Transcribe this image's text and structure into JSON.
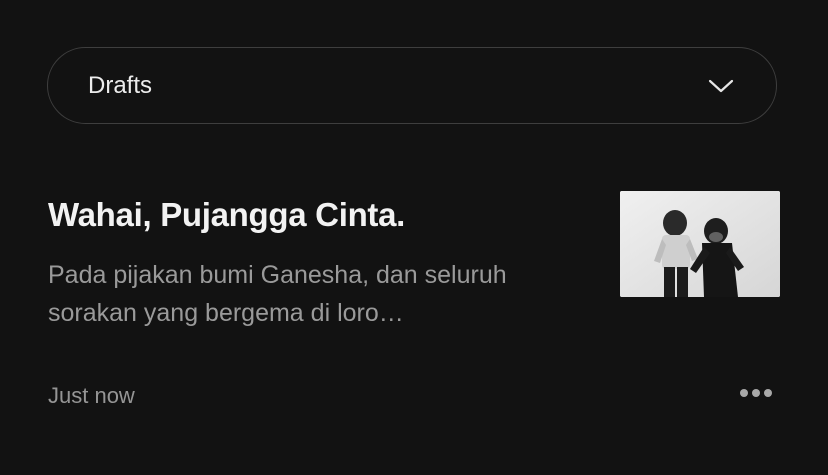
{
  "filter": {
    "selected": "Drafts",
    "icon": "chevron-down-icon"
  },
  "post": {
    "title": "Wahai, Pujangga Cinta.",
    "excerpt": "Pada pijakan bumi Ganesha, dan seluruh sorakan yang bergema di loro…",
    "timestamp": "Just now",
    "more_icon": "more-horizontal-icon"
  },
  "colors": {
    "background": "#121212",
    "border": "#3e3e3e",
    "title": "#f2f2f2",
    "muted": "#9a9a9a"
  }
}
